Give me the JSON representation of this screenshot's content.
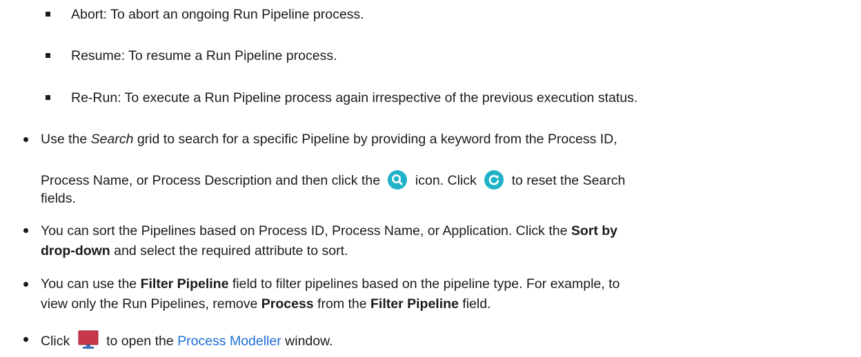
{
  "sub_bullets": [
    "Abort: To abort an ongoing Run Pipeline process.",
    "Resume: To resume a Run Pipeline process.",
    "Re-Run: To execute a Run Pipeline process again irrespective of the previous execution status."
  ],
  "search": {
    "p1": "Use the ",
    "search_word": "Search",
    "p2": " grid to search for a specific Pipeline by providing a keyword from the Process ID,",
    "p3": "Process Name, or Process Description and then click the ",
    "p4": " icon. Click ",
    "p5": " to reset the Search",
    "p6": "fields.",
    "search_icon": "search-icon",
    "reset_icon": "refresh-icon"
  },
  "sort": {
    "p1": "You can sort the Pipelines based on Process ID, Process Name, or Application. Click the ",
    "bold1": "Sort by",
    "bold2": "drop-down",
    "p2": " and select the required attribute to sort."
  },
  "filter": {
    "p1": "You can use the ",
    "bold1": "Filter Pipeline",
    "p2": " field to filter pipelines based on the pipeline type. For example, to",
    "p3": "view only the Run Pipelines, remove ",
    "bold2": "Process",
    "p4": " from the ",
    "bold3": "Filter Pipeline",
    "p5": " field."
  },
  "modeller": {
    "p1": "Click ",
    "p2": " to open the ",
    "link": "Process Modeller",
    "p3": " window.",
    "icon": "monitor-icon",
    "icon_color": "#c8374a",
    "link_color": "#1f6fd6"
  },
  "colors": {
    "icon_teal": "#1fb2c9",
    "text": "#1a1a1a"
  }
}
